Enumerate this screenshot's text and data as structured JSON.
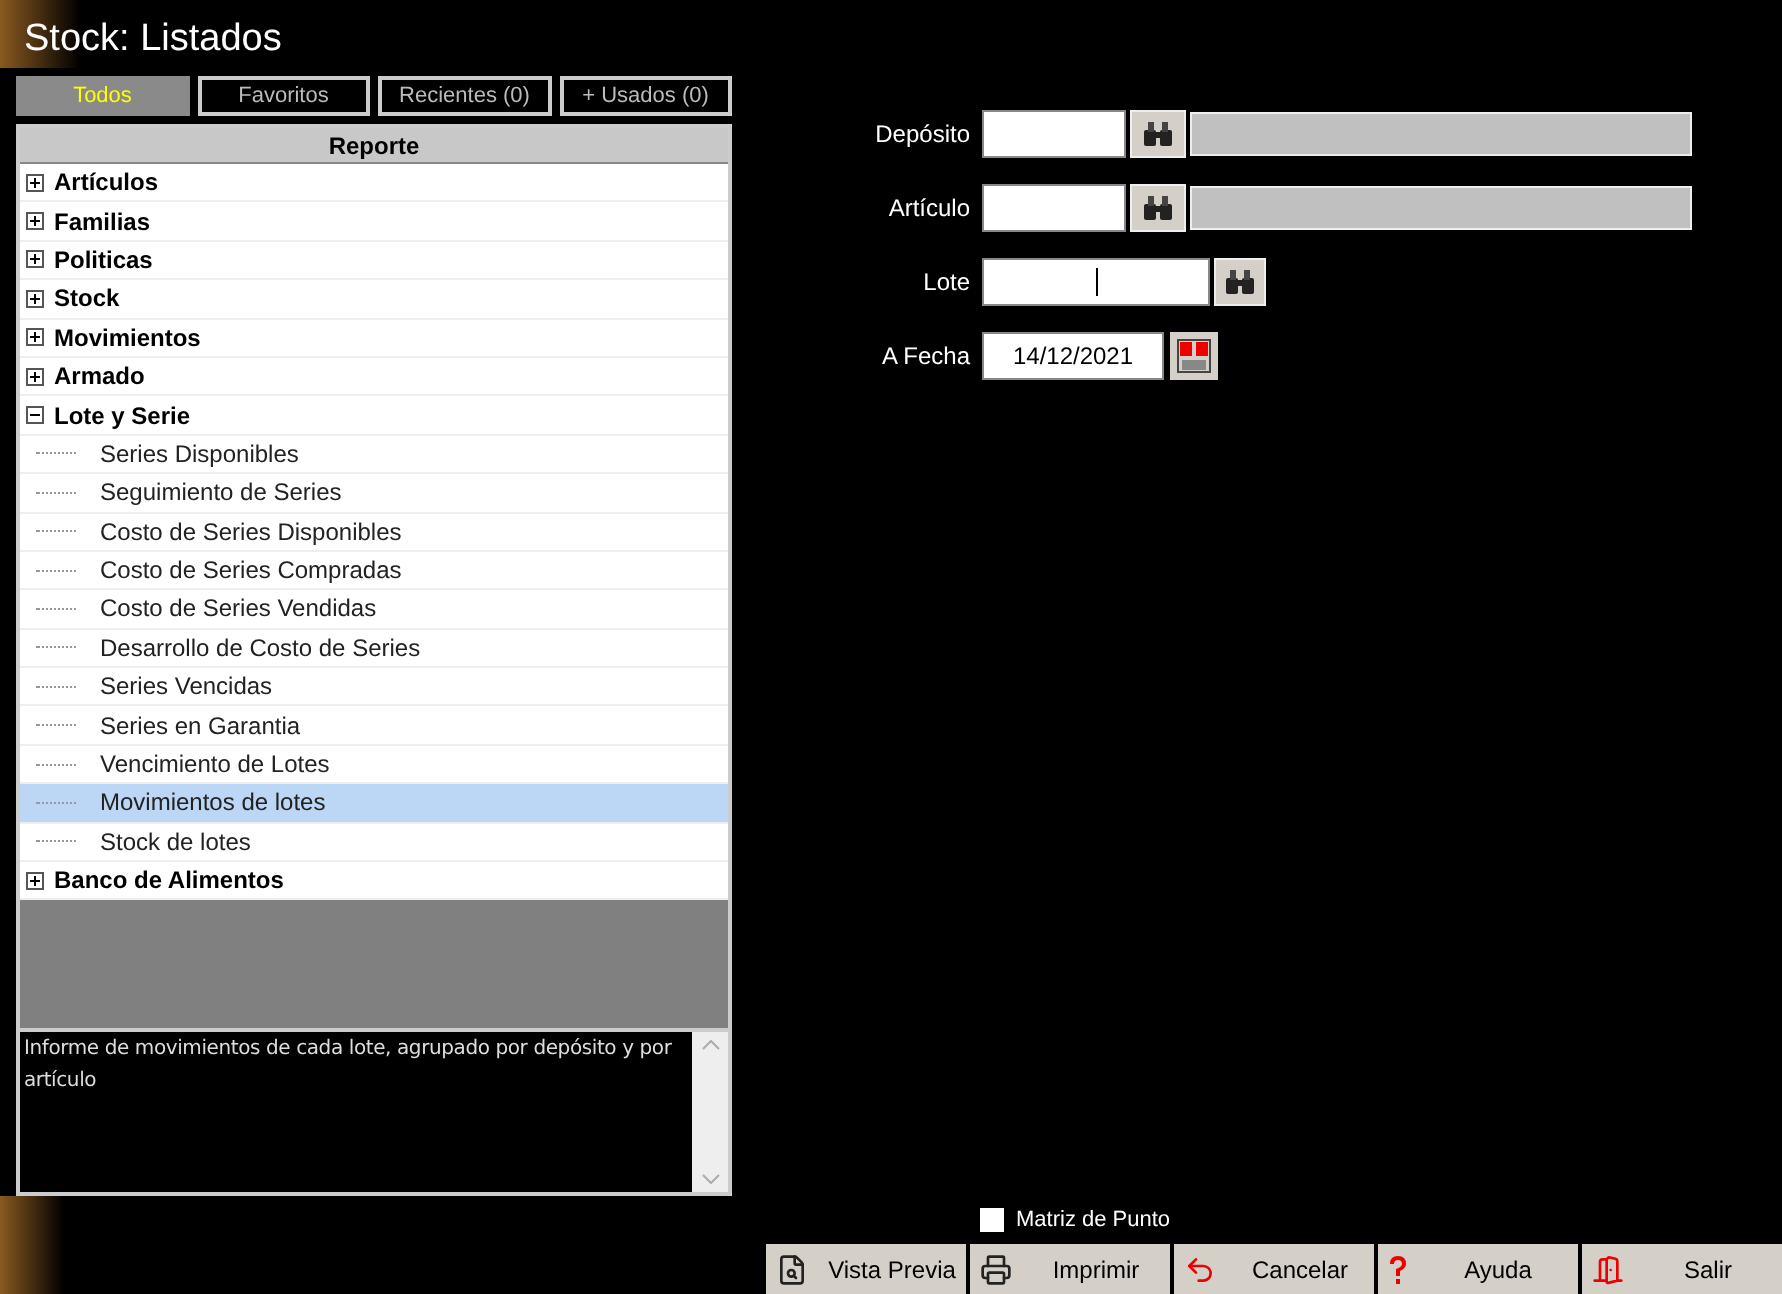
{
  "window": {
    "title": "Stock: Listados"
  },
  "tabs": [
    {
      "label": "Todos",
      "selected": true
    },
    {
      "label": "Favoritos",
      "selected": false
    },
    {
      "label": "Recientes (0)",
      "selected": false
    },
    {
      "label": "+ Usados (0)",
      "selected": false
    }
  ],
  "tree": {
    "header": "Reporte",
    "items": [
      {
        "label": "Artículos",
        "expanded": false
      },
      {
        "label": "Familias",
        "expanded": false
      },
      {
        "label": "Politicas",
        "expanded": false
      },
      {
        "label": "Stock",
        "expanded": false
      },
      {
        "label": "Movimientos",
        "expanded": false
      },
      {
        "label": "Armado",
        "expanded": false
      },
      {
        "label": "Lote y Serie",
        "expanded": true,
        "children": [
          {
            "label": "Series Disponibles",
            "selected": false
          },
          {
            "label": "Seguimiento de Series",
            "selected": false
          },
          {
            "label": "Costo de Series Disponibles",
            "selected": false
          },
          {
            "label": "Costo de Series Compradas",
            "selected": false
          },
          {
            "label": "Costo de Series Vendidas",
            "selected": false
          },
          {
            "label": "Desarrollo de Costo de Series",
            "selected": false
          },
          {
            "label": "Series Vencidas",
            "selected": false
          },
          {
            "label": "Series en Garantia",
            "selected": false
          },
          {
            "label": "Vencimiento de Lotes",
            "selected": false
          },
          {
            "label": "Movimientos de lotes",
            "selected": true
          },
          {
            "label": "Stock de lotes",
            "selected": false
          }
        ]
      },
      {
        "label": "Banco de Alimentos",
        "expanded": false
      }
    ]
  },
  "description": "Informe de movimientos de cada lote, agrupado por depósito y por artículo",
  "form": {
    "fields": [
      {
        "kind": "lookup",
        "label": "Depósito"
      },
      {
        "kind": "lookup",
        "label": "Artículo"
      },
      {
        "kind": "search",
        "label": "Lote"
      },
      {
        "kind": "date",
        "label": "A Fecha",
        "value": "14/12/2021"
      }
    ]
  },
  "checkbox": {
    "label": "Matriz de Punto",
    "checked": false
  },
  "buttons": [
    {
      "kind": "preview",
      "label": "Vista Previa"
    },
    {
      "kind": "print",
      "label": "Imprimir"
    },
    {
      "kind": "cancel",
      "label": "Cancelar"
    },
    {
      "kind": "help",
      "label": "Ayuda"
    },
    {
      "kind": "exit",
      "label": "Salir"
    }
  ]
}
